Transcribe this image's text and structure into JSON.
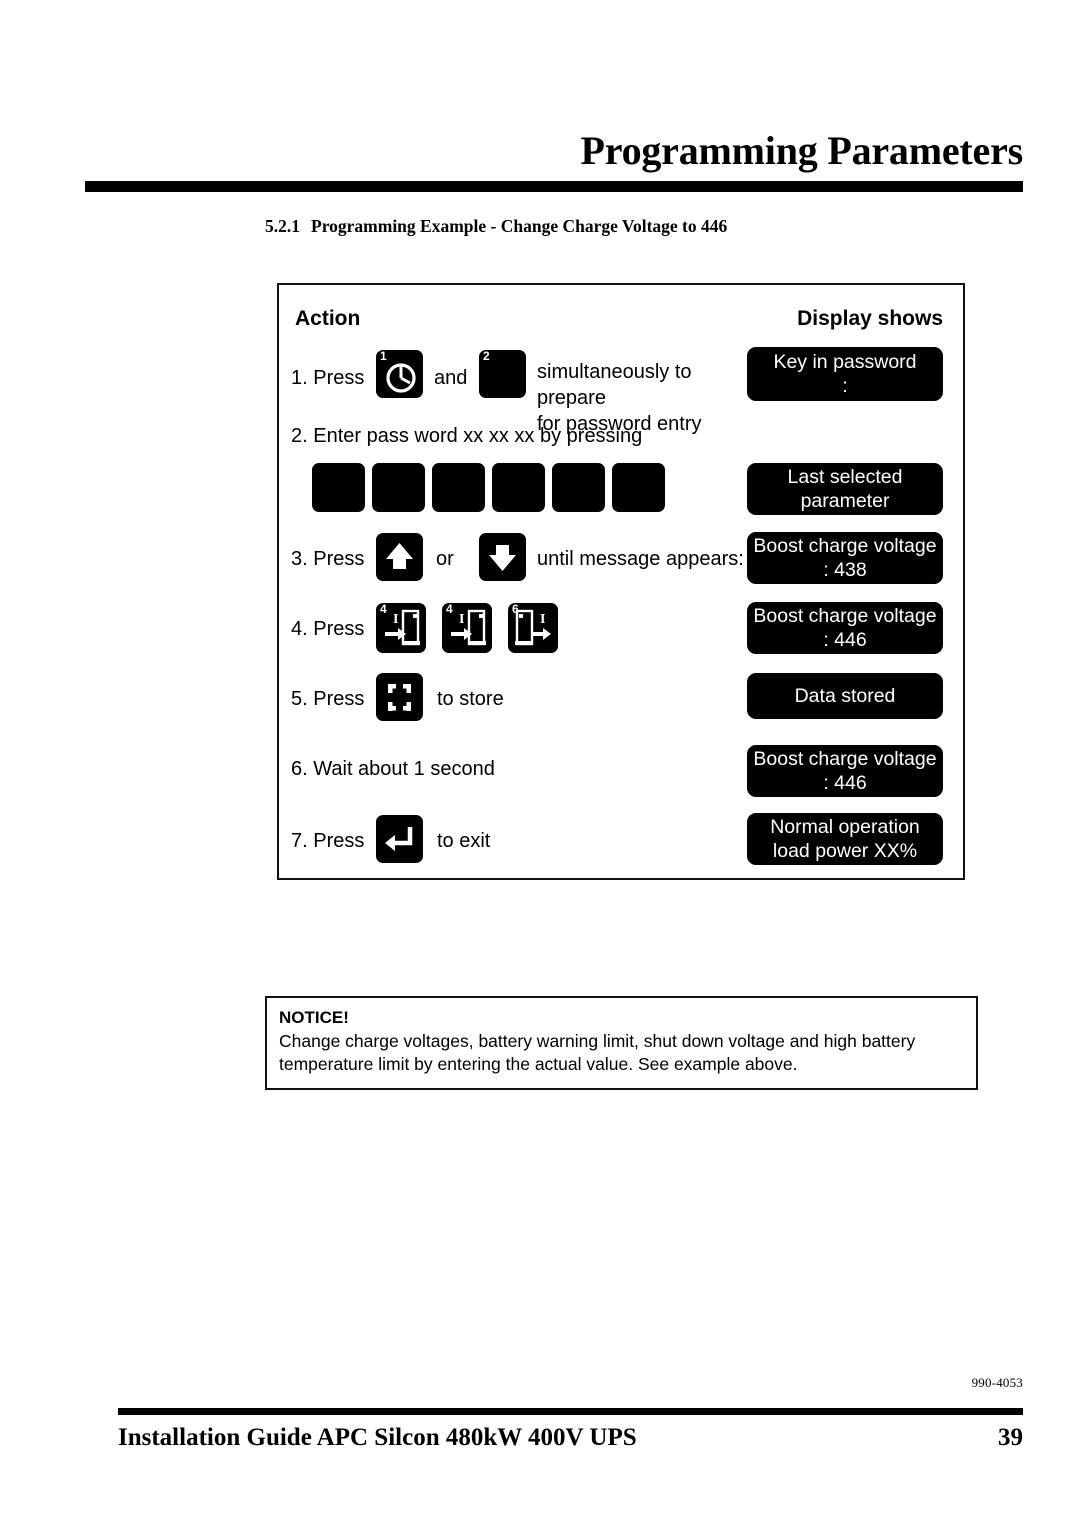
{
  "header": {
    "title": "Programming Parameters"
  },
  "section": {
    "number": "5.2.1",
    "title": "Programming Example - Change Charge Voltage to 446"
  },
  "table": {
    "col_action_label": "Action",
    "col_display_label": "Display shows",
    "steps": [
      {
        "id": "step-1",
        "num": "1. Press",
        "conjunction": "and",
        "text_line1": "simultaneously to prepare",
        "text_line2": "for password entry",
        "keys": [
          {
            "name": "key-alarm-reset",
            "sup": "1",
            "icon": "clock-alarm-icon"
          },
          {
            "name": "key-blank-2",
            "sup": "2",
            "icon": "blank-icon"
          }
        ],
        "display": {
          "line1": "Key in password",
          "line2": ":"
        }
      },
      {
        "id": "step-2",
        "num": "2. Enter pass word xx xx xx by pressing",
        "keys": [
          {
            "name": "key-password-1",
            "icon": "blank-icon"
          },
          {
            "name": "key-password-2",
            "icon": "blank-icon"
          },
          {
            "name": "key-password-3",
            "icon": "blank-icon"
          },
          {
            "name": "key-password-4",
            "icon": "blank-icon"
          },
          {
            "name": "key-password-5",
            "icon": "blank-icon"
          },
          {
            "name": "key-password-6",
            "icon": "blank-icon"
          }
        ],
        "display": {
          "line1": "Last selected",
          "line2": "parameter"
        }
      },
      {
        "id": "step-3",
        "num": "3. Press",
        "conjunction": "or",
        "text_line1": "until message appears:",
        "keys": [
          {
            "name": "key-arrow-up",
            "icon": "arrow-up-icon"
          },
          {
            "name": "key-arrow-down",
            "icon": "arrow-down-icon"
          }
        ],
        "display": {
          "line1": "Boost charge voltage",
          "line2": ": 438"
        }
      },
      {
        "id": "step-4",
        "num": "4. Press",
        "keys": [
          {
            "name": "key-digit-4-enter-a",
            "sup": "4",
            "icon": "enter-door-icon"
          },
          {
            "name": "key-digit-4-enter-b",
            "sup": "4",
            "icon": "enter-door-icon"
          },
          {
            "name": "key-digit-6-exit",
            "sup": "6",
            "icon": "exit-door-icon"
          }
        ],
        "display": {
          "line1": "Boost charge voltage",
          "line2": ": 446"
        }
      },
      {
        "id": "step-5",
        "num": "5. Press",
        "text_line1": "to store",
        "keys": [
          {
            "name": "key-store",
            "icon": "store-frame-icon"
          }
        ],
        "display": {
          "line1": "Data stored",
          "line2": ""
        }
      },
      {
        "id": "step-6",
        "num": "6. Wait about 1 second",
        "keys": [],
        "display": {
          "line1": "Boost charge voltage",
          "line2": ": 446"
        }
      },
      {
        "id": "step-7",
        "num": "7. Press",
        "text_line1": "to exit",
        "keys": [
          {
            "name": "key-enter-exit",
            "icon": "enter-return-icon"
          }
        ],
        "display": {
          "line1": "Normal operation",
          "line2": "load power XX%"
        }
      }
    ]
  },
  "notice": {
    "title": "NOTICE!",
    "body": "Change charge voltages, battery warning limit, shut down voltage and high battery temperature limit by entering the actual value. See example above."
  },
  "doc_number": "990-4053",
  "footer": {
    "title": "Installation Guide APC Silcon 480kW 400V UPS",
    "page": "39"
  },
  "colors": {
    "ink": "#000000",
    "paper": "#ffffff",
    "key_fill": "#000000",
    "key_glyph": "#ffffff"
  }
}
